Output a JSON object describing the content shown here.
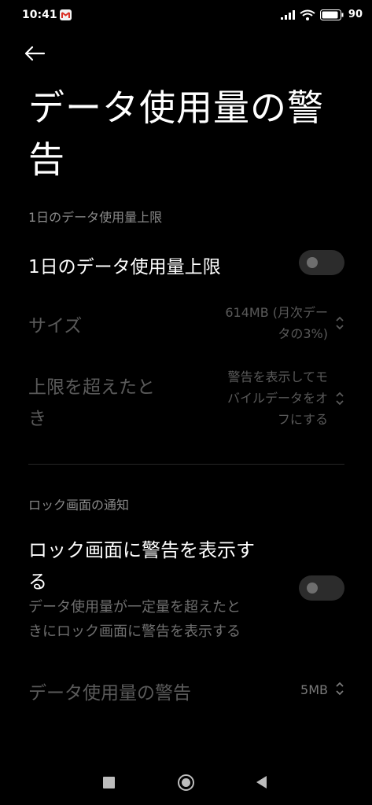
{
  "status_bar": {
    "time": "10:41",
    "battery_percent": "90"
  },
  "header": {
    "title": "データ使用量の警告"
  },
  "daily_limit_section": {
    "header": "1日のデータ使用量上限",
    "toggle_label": "1日のデータ使用量上限",
    "toggle_on": false,
    "size_label": "サイズ",
    "size_value": "614MB (月次データの3%)",
    "size_value_line1": "614MB (月次デー",
    "size_value_line2": "タの3%)",
    "over_limit_label": "上限を超えたとき",
    "over_limit_label_line1": "上限を超えたと",
    "over_limit_label_line2": "き",
    "over_limit_value": "警告を表示してモバイルデータをオフにする",
    "over_limit_value_line1": "警告を表示してモ",
    "over_limit_value_line2": "バイルデータをオ",
    "over_limit_value_line3": "フにする"
  },
  "lock_screen_section": {
    "header": "ロック画面の通知",
    "toggle_label_line1": "ロック画面に警告を表示す",
    "toggle_label_line2": "る",
    "toggle_on": false,
    "description_line1": "データ使用量が一定量を超えたと",
    "description_line2": "きにロック画面に警告を表示する",
    "warning_label": "データ使用量の警告",
    "warning_value": "5MB"
  },
  "colors": {
    "background": "#000000",
    "text_primary": "#ffffff",
    "text_disabled": "#5a5a5a",
    "toggle_off_track": "#2c2c2c"
  }
}
